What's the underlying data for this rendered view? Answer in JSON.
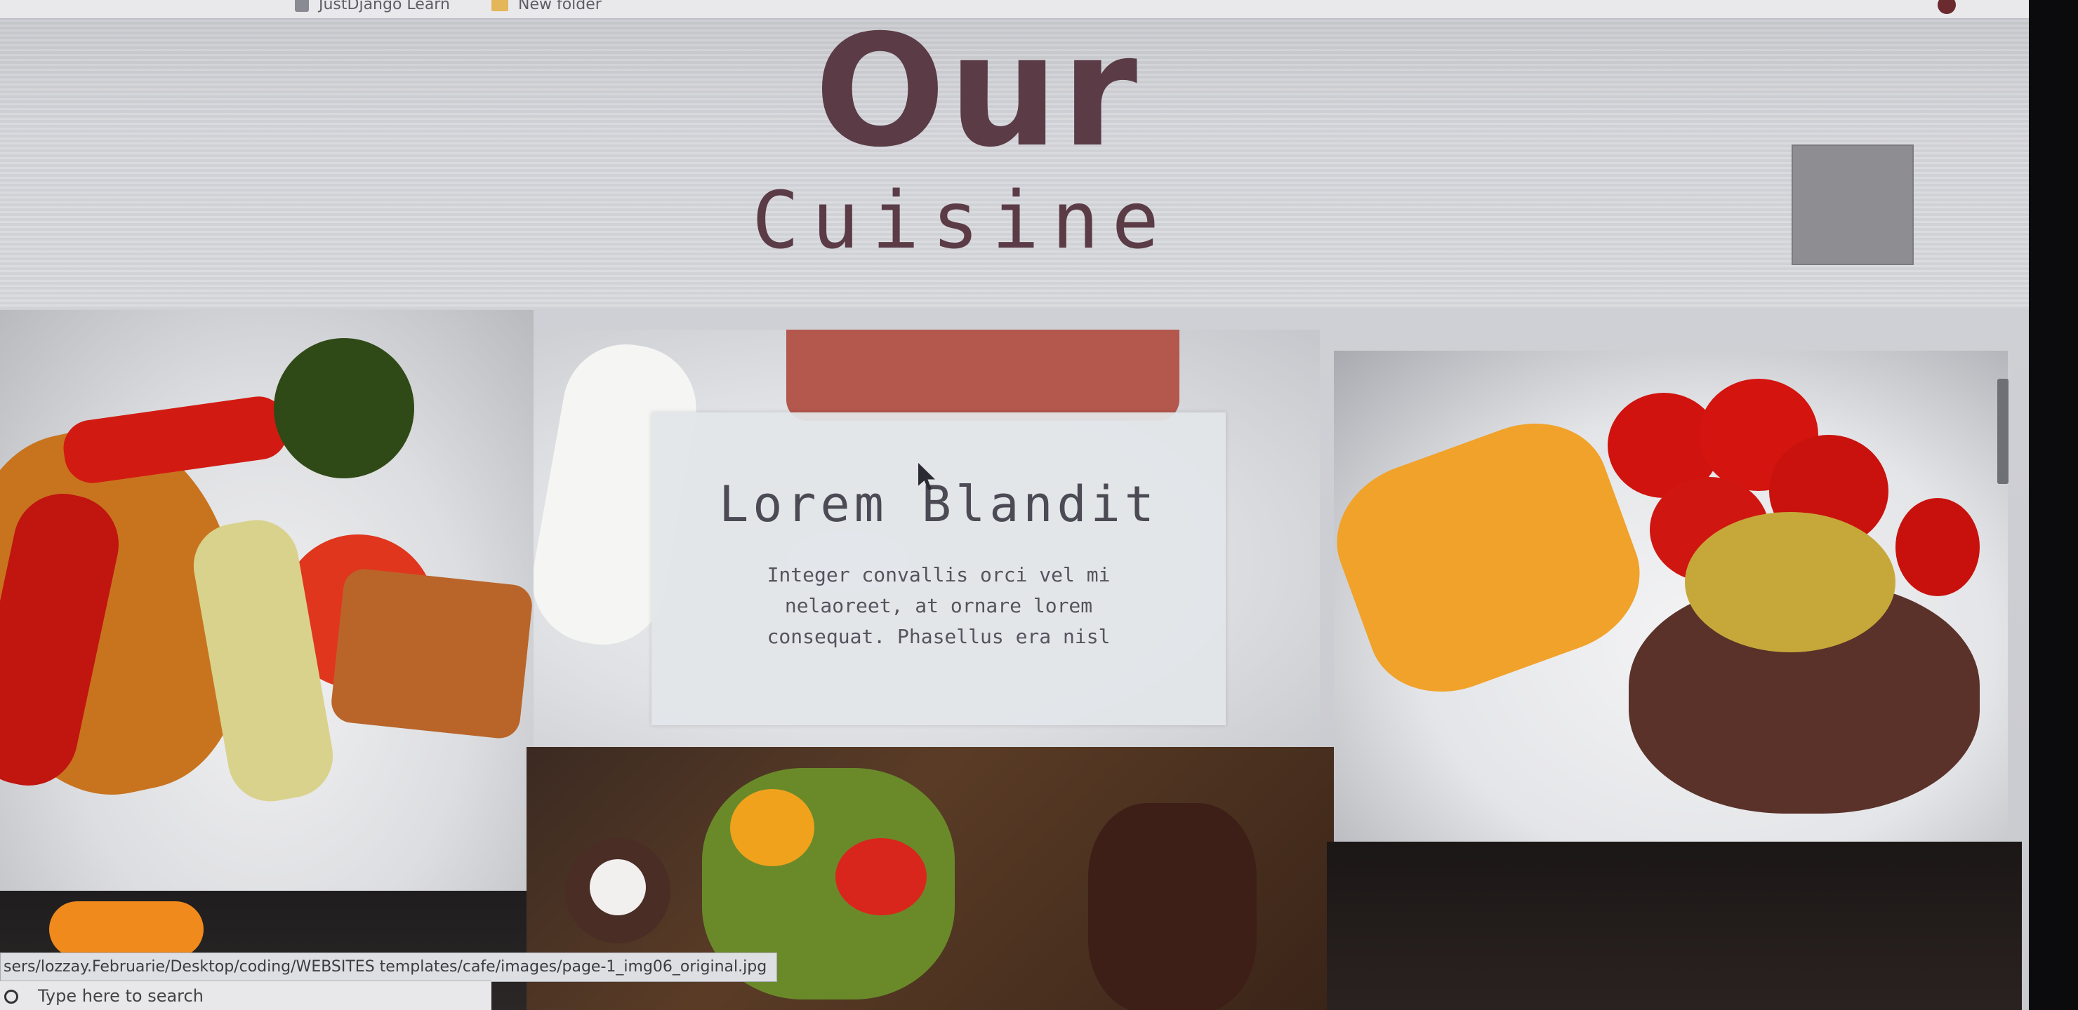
{
  "bookmarks_bar": {
    "items": [
      {
        "label": "JustDjango Learn",
        "icon": "bookmark-favicon"
      },
      {
        "label": "New folder",
        "icon": "folder-icon"
      }
    ]
  },
  "hero": {
    "title_line1": "Our",
    "title_line2": "Cuisine"
  },
  "card": {
    "title": "Lorem Blandit",
    "text_lines": [
      "Integer convallis orci vel mi",
      "nelaoreet, at ornare lorem",
      "consequat. Phasellus era nisl"
    ]
  },
  "status_bar": {
    "url": "sers/lozzay.Februarie/Desktop/coding/WEBSITES templates/cafe/images/page-1_img06_original.jpg"
  },
  "taskbar": {
    "search_placeholder": "Type here to search"
  },
  "colors": {
    "heading": "#5b3c46",
    "card_text": "#4b4a55",
    "background": "#d4d5da"
  }
}
